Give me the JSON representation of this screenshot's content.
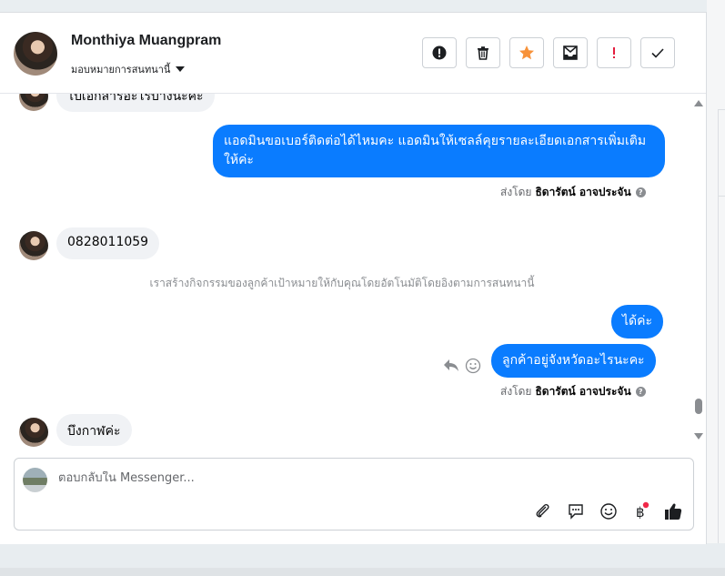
{
  "header": {
    "name": "Monthiya Muangpram",
    "assign_label": "มอบหมายการสนทนานี้",
    "toolbar": {
      "spam_icon": "alert-circle-icon",
      "delete_icon": "trash-icon",
      "star_icon": "star-icon",
      "mark_unread_icon": "envelope-icon",
      "follow_up_icon": "exclamation-icon",
      "done_icon": "check-icon"
    }
  },
  "messages": {
    "partial_top": "ไปเอกสารอะไรบ้างนะคะ",
    "out_1": "แอดมินขอเบอร์ติดต่อได้ไหมคะ แอดมินให้เซลล์คุยรายละเอียดเอกสารเพิ่มเติมให้ค่ะ",
    "sent_by_label": "ส่งโดย",
    "sender_name": "ธิดารัตน์ อาจประจัน",
    "in_phone": "0828011059",
    "system_note": "เราสร้างกิจกรรมของลูกค้าเป้าหมายให้กับคุณโดยอัตโนมัติโดยอิงตามการสนทนานี้",
    "out_2": "ได้ค่ะ",
    "out_3": "ลูกค้าอยู่จังหวัดอะไรนะคะ",
    "in_last": "บึงกาฬค่ะ"
  },
  "composer": {
    "placeholder": "ตอบกลับใน Messenger...",
    "icons": [
      "paperclip-icon",
      "saved-reply-icon",
      "emoji-icon",
      "baht-payment-icon",
      "thumbs-up-icon"
    ]
  },
  "colors": {
    "accent": "#0a7cff",
    "star": "#f7923a",
    "follow_up": "#e41e3f",
    "notification_dot": "#f02849"
  }
}
